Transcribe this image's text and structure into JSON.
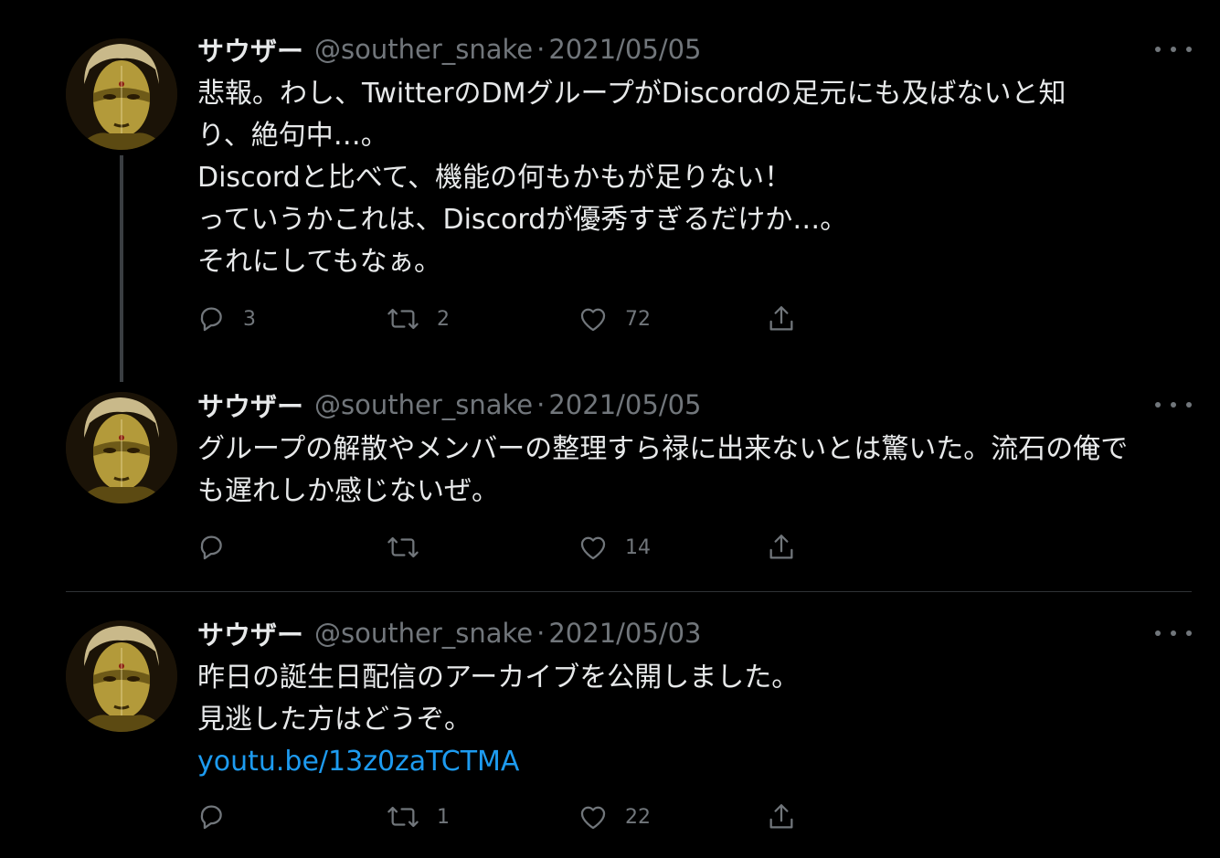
{
  "tweets": [
    {
      "name": "サウザー",
      "handle": "@souther_snake",
      "separator": "·",
      "date": "2021/05/05",
      "lines": [
        "悲報。わし、TwitterのDMグループがDiscordの足元にも及ばないと知",
        "り、絶句中…。",
        "Discordと比べて、機能の何もかもが足りない！",
        "っていうかこれは、Discordが優秀すぎるだけか…。",
        "それにしてもなぁ。"
      ],
      "replies": "3",
      "retweets": "2",
      "likes": "72"
    },
    {
      "name": "サウザー",
      "handle": "@souther_snake",
      "separator": "·",
      "date": "2021/05/05",
      "lines": [
        "グループの解散やメンバーの整理すら禄に出来ないとは驚いた。流石の俺で",
        "も遅れしか感じないぜ。"
      ],
      "replies": "",
      "retweets": "",
      "likes": "14"
    },
    {
      "name": "サウザー",
      "handle": "@souther_snake",
      "separator": "·",
      "date": "2021/05/03",
      "lines": [
        "昨日の誕生日配信のアーカイブを公開しました。",
        "見逃した方はどうぞ。"
      ],
      "link": "youtu.be/13z0zaTCTMA",
      "replies": "",
      "retweets": "1",
      "likes": "22"
    }
  ],
  "icons": {
    "avatar": "avatar-image",
    "more": "more-icon",
    "reply": "reply-icon",
    "retweet": "retweet-icon",
    "like": "like-icon",
    "share": "share-icon"
  },
  "colors": {
    "background": "#000000",
    "text": "#e7e9ea",
    "secondary": "#71767b",
    "link": "#1d9bf0",
    "thread_line": "#3a3e42",
    "divider": "#2f3336"
  }
}
